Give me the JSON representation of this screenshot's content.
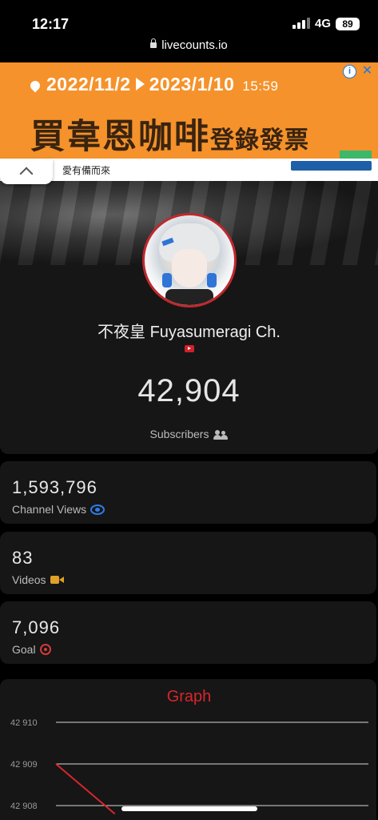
{
  "status_bar": {
    "time": "12:17",
    "network": "4G",
    "battery": "89"
  },
  "browser": {
    "url": "livecounts.io"
  },
  "ad": {
    "date_from": "2022/11/2",
    "date_to": "2023/1/10",
    "time": "15:59",
    "headline": "買韋恩咖啡",
    "headline_sub": "登錄發票",
    "strip_text": "愛有備而來",
    "info_icon": "i",
    "close_icon": "✕"
  },
  "channel": {
    "name": "不夜皇 Fuyasumeragi Ch.",
    "platform_icon": "youtube-icon",
    "subscribers": "42,904",
    "subscribers_label": "Subscribers"
  },
  "stats": [
    {
      "value": "1,593,796",
      "label": "Channel Views",
      "icon": "eye-icon"
    },
    {
      "value": "83",
      "label": "Videos",
      "icon": "video-camera-icon"
    },
    {
      "value": "7,096",
      "label": "Goal",
      "icon": "target-icon"
    }
  ],
  "colors": {
    "accent_red": "#d9252c",
    "views_blue": "#2f7be6",
    "videos_amber": "#e0a126",
    "card_bg": "#161616",
    "ad_orange": "#f5922b"
  },
  "chart_data": {
    "type": "line",
    "title": "Graph",
    "ytick_labels": [
      "42 910",
      "42 909",
      "42 908"
    ],
    "ylim": [
      42907.5,
      42910.2
    ],
    "grid": true,
    "series": [
      {
        "points": [
          [
            0,
            42909
          ],
          [
            1,
            42907.8
          ]
        ]
      }
    ],
    "xlim": [
      0,
      5.3
    ]
  }
}
